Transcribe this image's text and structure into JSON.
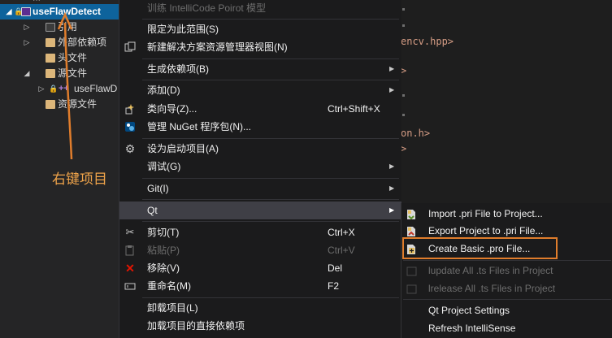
{
  "explorer": {
    "project_name": "useFlawDetect",
    "top_partial": "...",
    "items": [
      {
        "label": "引用"
      },
      {
        "label": "外部依赖项"
      },
      {
        "label": "头文件"
      },
      {
        "label": "源文件"
      },
      {
        "label": "useFlawD"
      },
      {
        "label": "资源文件"
      }
    ]
  },
  "editor": {
    "lines": [
      "encv.hpp>",
      ">",
      "on.h>",
      ">"
    ]
  },
  "annotation": {
    "text": "右键项目",
    "color": "#f0a44a"
  },
  "context_menu": {
    "items": [
      {
        "label": "训练 IntelliCode Poirot 模型",
        "disabled": true
      },
      {
        "label": "限定为此范围(S)"
      },
      {
        "label": "新建解决方案资源管理器视图(N)"
      },
      {
        "label": "生成依赖项(B)",
        "submenu": true
      },
      {
        "label": "添加(D)",
        "submenu": true
      },
      {
        "label": "类向导(Z)...",
        "shortcut": "Ctrl+Shift+X"
      },
      {
        "label": "管理 NuGet 程序包(N)..."
      },
      {
        "label": "设为启动项目(A)"
      },
      {
        "label": "调试(G)",
        "submenu": true
      },
      {
        "label": "Git(I)",
        "submenu": true
      },
      {
        "label": "Qt",
        "submenu": true,
        "highlighted": true
      },
      {
        "label": "剪切(T)",
        "shortcut": "Ctrl+X"
      },
      {
        "label": "粘贴(P)",
        "shortcut": "Ctrl+V",
        "disabled": true
      },
      {
        "label": "移除(V)",
        "shortcut": "Del"
      },
      {
        "label": "重命名(M)",
        "shortcut": "F2"
      },
      {
        "label": "卸载项目(L)"
      },
      {
        "label": "加载项目的直接依赖项"
      }
    ]
  },
  "qt_submenu": {
    "items": [
      {
        "label": "Import .pri File to Project..."
      },
      {
        "label": "Export Project to .pri File..."
      },
      {
        "label": "Create Basic .pro File...",
        "annotated": true
      },
      {
        "label": "lupdate All .ts Files in Project",
        "disabled": true
      },
      {
        "label": "lrelease All .ts Files in Project",
        "disabled": true
      },
      {
        "label": "Qt Project Settings"
      },
      {
        "label": "Refresh IntelliSense"
      }
    ]
  },
  "icons": {
    "submenu_arrow": "chevron-right-icon",
    "annotation_highlight": "#e07d2c",
    "selection": "#0e639c"
  }
}
